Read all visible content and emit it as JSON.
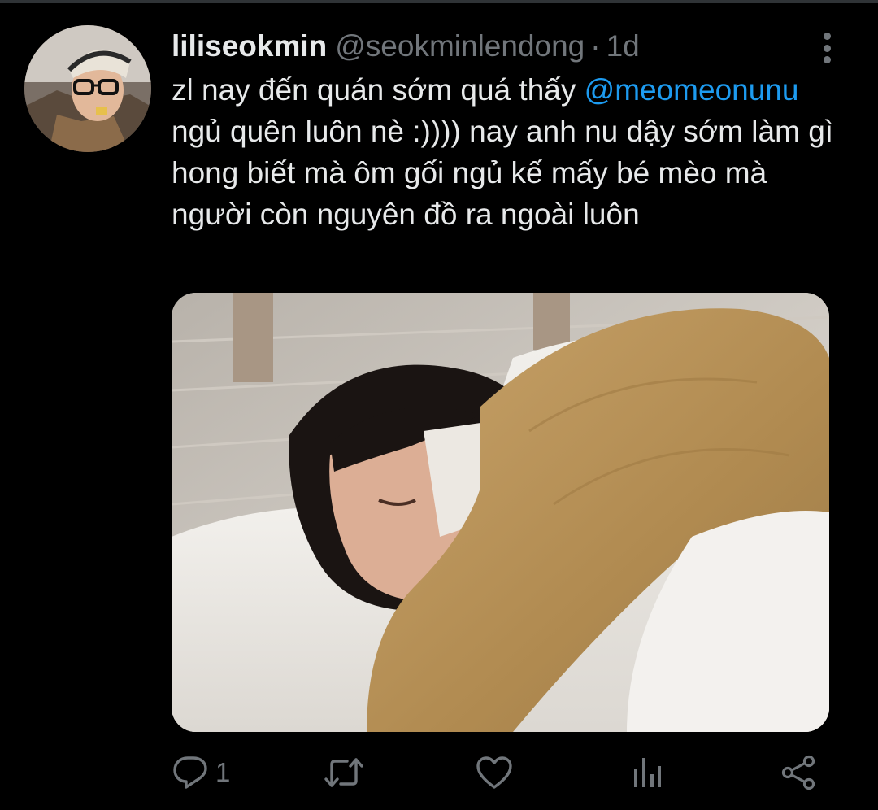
{
  "tweet": {
    "display_name": "liliseokmin",
    "handle": "@seokminlendong",
    "separator": "·",
    "time": "1d",
    "text_parts": [
      "zl nay đến quán sớm quá thấy ",
      "@meomeonunu",
      " ngủ quên luôn nè :)))) nay anh nu dậy sớm làm gì hong biết mà ôm gối ngủ kế mấy bé mèo mà người còn nguyên đồ ra ngoài luôn"
    ],
    "actions": {
      "reply_icon": "reply-icon",
      "reply_count": "1",
      "retweet_icon": "retweet-icon",
      "like_icon": "heart-icon",
      "analytics_icon": "analytics-icon",
      "share_icon": "share-icon"
    },
    "more_icon": "more-vertical-icon"
  },
  "colors": {
    "background": "#000000",
    "text": "#e7e9ea",
    "secondary": "#71767b",
    "link": "#1d9bf0"
  }
}
